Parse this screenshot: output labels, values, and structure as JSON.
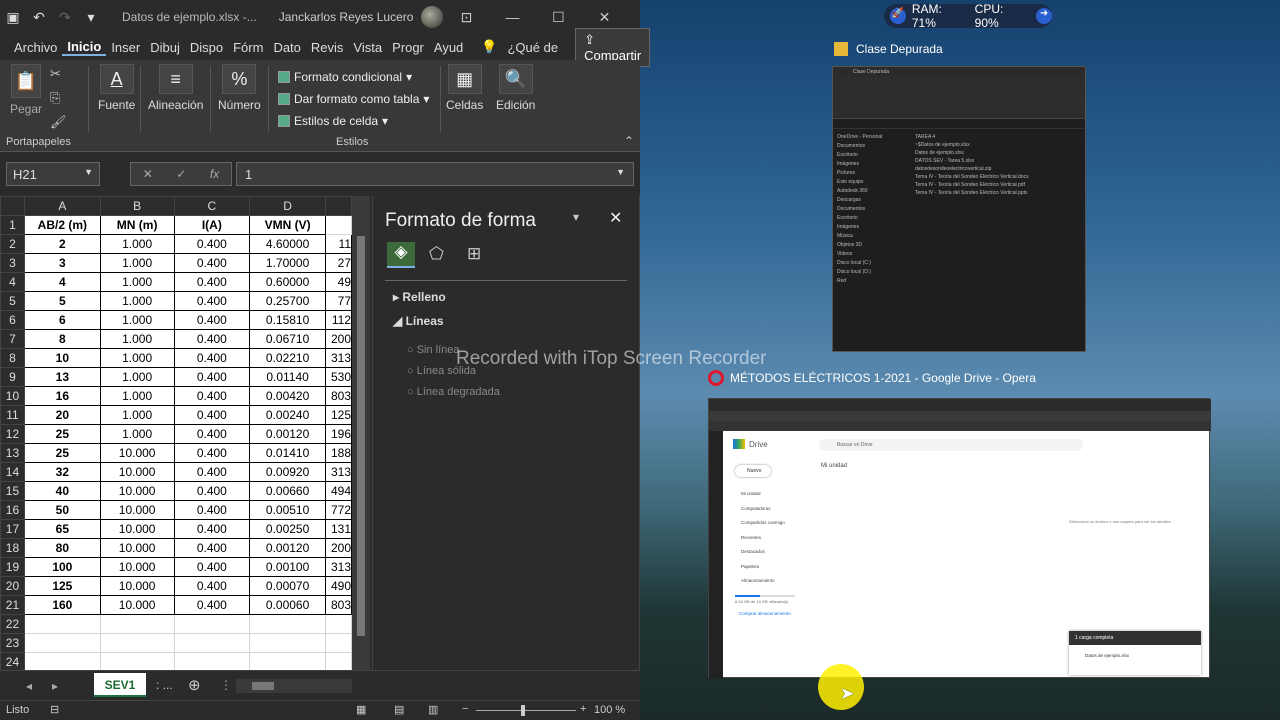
{
  "excel": {
    "file_title": "Datos de ejemplo.xlsx  -...",
    "user": "Janckarlos Reyes Lucero",
    "menu": [
      "Archivo",
      "Inicio",
      "Inser",
      "Dibuj",
      "Dispo",
      "Fórm",
      "Dato",
      "Revis",
      "Vista",
      "Progr",
      "Ayud"
    ],
    "whatis": "¿Qué de",
    "share": "Compartir",
    "ribbon": {
      "pegar": "Pegar",
      "portapapeles": "Portapapeles",
      "fuente": "Fuente",
      "alineacion": "Alineación",
      "numero": "Número",
      "formato_condicional": "Formato condicional",
      "dar_formato": "Dar formato como tabla",
      "estilos_celda": "Estilos de celda",
      "estilos": "Estilos",
      "celdas": "Celdas",
      "edicion": "Edición"
    },
    "namebox": "H21",
    "formula_value": "1",
    "columns": [
      "A",
      "B",
      "C",
      "D"
    ],
    "headers": [
      "AB/2 (m)",
      "MN (m)",
      "I(A)",
      "VMN (V)"
    ],
    "rows": [
      [
        "2",
        "1.000",
        "0.400",
        "4.60000",
        "11"
      ],
      [
        "3",
        "1.000",
        "0.400",
        "1.70000",
        "27"
      ],
      [
        "4",
        "1.000",
        "0.400",
        "0.60000",
        "49"
      ],
      [
        "5",
        "1.000",
        "0.400",
        "0.25700",
        "77"
      ],
      [
        "6",
        "1.000",
        "0.400",
        "0.15810",
        "112"
      ],
      [
        "8",
        "1.000",
        "0.400",
        "0.06710",
        "200"
      ],
      [
        "10",
        "1.000",
        "0.400",
        "0.02210",
        "313"
      ],
      [
        "13",
        "1.000",
        "0.400",
        "0.01140",
        "530"
      ],
      [
        "16",
        "1.000",
        "0.400",
        "0.00420",
        "803"
      ],
      [
        "20",
        "1.000",
        "0.400",
        "0.00240",
        "125"
      ],
      [
        "25",
        "1.000",
        "0.400",
        "0.00120",
        "196"
      ],
      [
        "25",
        "10.000",
        "0.400",
        "0.01410",
        "188"
      ],
      [
        "32",
        "10.000",
        "0.400",
        "0.00920",
        "313"
      ],
      [
        "40",
        "10.000",
        "0.400",
        "0.00660",
        "494"
      ],
      [
        "50",
        "10.000",
        "0.400",
        "0.00510",
        "772"
      ],
      [
        "65",
        "10.000",
        "0.400",
        "0.00250",
        "131"
      ],
      [
        "80",
        "10.000",
        "0.400",
        "0.00120",
        "200"
      ],
      [
        "100",
        "10.000",
        "0.400",
        "0.00100",
        "313"
      ],
      [
        "125",
        "10.000",
        "0.400",
        "0.00070",
        "490"
      ],
      [
        "160",
        "10.000",
        "0.400",
        "0.00060",
        "803"
      ]
    ],
    "row_numbers": [
      "1",
      "2",
      "3",
      "4",
      "5",
      "6",
      "7",
      "8",
      "9",
      "10",
      "11",
      "12",
      "13",
      "14",
      "15",
      "16",
      "17",
      "18",
      "19",
      "20",
      "21",
      "22",
      "23",
      "24"
    ],
    "pane": {
      "title": "Formato de forma",
      "relleno": "Relleno",
      "lineas": "Líneas",
      "options": [
        "Sin línea",
        "Línea sólida",
        "Línea degradada"
      ]
    },
    "sheet_tab": "SEV1",
    "status": "Listo",
    "zoom": "100 %"
  },
  "watermark": "Recorded with iTop Screen Recorder",
  "sysmon": {
    "ram": "RAM: 71%",
    "cpu": "CPU: 90%"
  },
  "explorer": {
    "title": "Clase Depurada",
    "files": [
      "TAREA 4",
      "~$Datos de ejemplo.xlsx",
      "Datos de ejemplo.xlsx",
      "DATOS SEV - Tarea 5.xlsx",
      "datosdesondeoelectricovertical.zip",
      "Tema IV - Teoría del Sondeo Eléctrico Vertical.docx",
      "Tema IV - Teoría del Sondeo Eléctrico Vertical.pdf",
      "Tema IV - Teoría del Sondeo Eléctrico Vertical.pptx"
    ],
    "nav": [
      "OneDrive - Personal",
      "Documentos",
      "Escritorio",
      "Imágenes",
      "Pictures",
      "Este equipo",
      "Autodesk 360",
      "Descargas",
      "Documentos",
      "Escritorio",
      "Imágenes",
      "Música",
      "Objetos 3D",
      "Videos",
      "Disco local (C:)",
      "Disco local (D:)",
      "Red"
    ]
  },
  "opera": {
    "title": "MÉTODOS ELÉCTRICOS 1-2021 - Google Drive - Opera",
    "drive_label": "Drive",
    "search": "Buscar en Drive",
    "my_unit": "Mi unidad",
    "new": "Nuevo",
    "side": [
      "Mi unidad",
      "Computadoras",
      "Compartidos conmigo",
      "Recientes",
      "Destacados",
      "Papelera",
      "Almacenamiento"
    ],
    "storage": "6.24 GB de 15 GB utilizado(s)",
    "buy": "Comprar almacenamiento",
    "detail_hint": "Selecciona un archivo o una carpeta para ver los detalles",
    "upload_title": "1 carga completa",
    "upload_file": "Datos de ejemplo.xlsx"
  }
}
